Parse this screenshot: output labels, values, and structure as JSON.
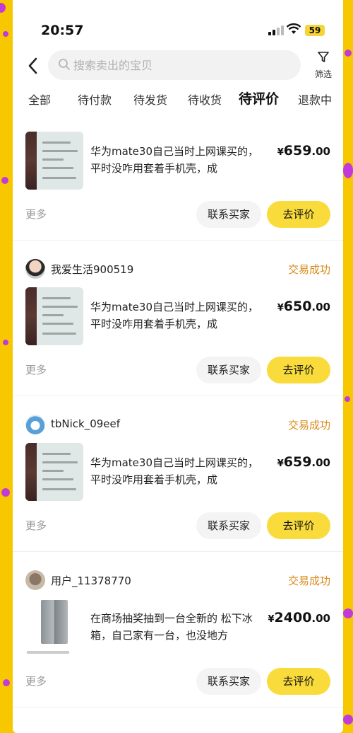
{
  "status_bar": {
    "time": "20:57",
    "battery": "59"
  },
  "search": {
    "placeholder": "搜索卖出的宝贝"
  },
  "filter": {
    "label": "筛选"
  },
  "tabs": [
    {
      "label": "全部"
    },
    {
      "label": "待付款"
    },
    {
      "label": "待发货"
    },
    {
      "label": "待收货"
    },
    {
      "label": "待评价",
      "active": true
    },
    {
      "label": "退款中"
    }
  ],
  "orders": [
    {
      "seller": "",
      "status": "",
      "title": "华为mate30自己当时上网课买的，平时没咋用套着手机壳，成",
      "price_int": "659",
      "price_dec": ".00",
      "yen": "¥",
      "more": "更多",
      "contact": "联系买家",
      "review": "去评价"
    },
    {
      "seller": "我爱生活900519",
      "status": "交易成功",
      "title": "华为mate30自己当时上网课买的，平时没咋用套着手机壳，成",
      "price_int": "650",
      "price_dec": ".00",
      "yen": "¥",
      "more": "更多",
      "contact": "联系买家",
      "review": "去评价"
    },
    {
      "seller": "tbNick_09eef",
      "status": "交易成功",
      "title": "华为mate30自己当时上网课买的，平时没咋用套着手机壳，成",
      "price_int": "659",
      "price_dec": ".00",
      "yen": "¥",
      "more": "更多",
      "contact": "联系买家",
      "review": "去评价"
    },
    {
      "seller": "用户_11378770",
      "status": "交易成功",
      "title": "在商场抽奖抽到一台全新的 松下冰箱，自己家有一台，也没地方",
      "price_int": "2400",
      "price_dec": ".00",
      "yen": "¥",
      "more": "更多",
      "contact": "联系买家",
      "review": "去评价"
    }
  ],
  "colors": {
    "accent": "#f9dc3c",
    "status": "#d98a1a",
    "background": "#f7c800",
    "dots": "#c23bd8"
  }
}
